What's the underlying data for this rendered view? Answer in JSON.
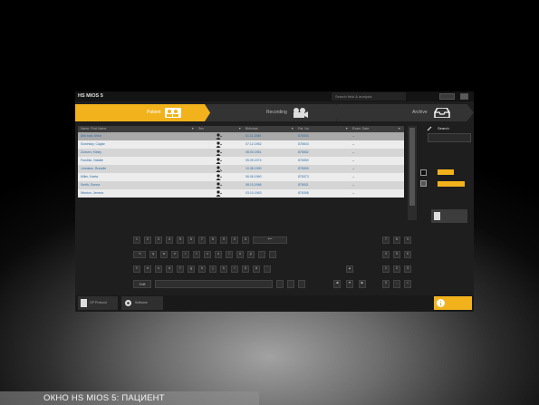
{
  "app": {
    "title": "HS MIOS 5",
    "search_placeholder": "Search field & analysis"
  },
  "tabs": [
    {
      "label": "Patient",
      "icon": "patients-icon",
      "active": true
    },
    {
      "label": "Recording",
      "icon": "camera-icon",
      "active": false
    },
    {
      "label": "Archive",
      "icon": "inbox-icon",
      "active": false
    }
  ],
  "table": {
    "headers": [
      "Name, First Name",
      "Sex",
      "Birthdate",
      "Pat. No.",
      "Exam. Date"
    ],
    "rows": [
      [
        "Abs bad, Ahnd",
        "",
        "01.11.1985",
        "876534",
        "--"
      ],
      [
        "Sowinsky, Caglar",
        "",
        "07.12.1962",
        "876543",
        "--"
      ],
      [
        "Zunsen, Kiesly",
        "",
        "08.03.1961",
        "876562",
        "--"
      ],
      [
        "Fandisk, Natalie",
        "",
        "05.09.1974",
        "876590",
        "--"
      ],
      [
        "Johnston, Brandie",
        "",
        "10.08.1990",
        "876590",
        "--"
      ],
      [
        "Miller, Kaeta",
        "",
        "06.06.1960",
        "876373",
        "--"
      ],
      [
        "Smith, Donna",
        "",
        "08.10.1966",
        "876531",
        "--"
      ],
      [
        "Weston, Jemma",
        "",
        "03.10.1963",
        "876398",
        "--"
      ]
    ]
  },
  "right_panel": {
    "search_label": "Search"
  },
  "keyboard": {
    "row1": [
      "1",
      "2",
      "3",
      "4",
      "5",
      "6",
      "7",
      "8",
      "9",
      "0",
      "ß"
    ],
    "row1_back": "⟵",
    "row2_tab": "⇥",
    "row2": [
      "q",
      "w",
      "e",
      "r",
      "t",
      "z",
      "u",
      "i",
      "o",
      "p"
    ],
    "row3_caps": "⇪",
    "row3": [
      "a",
      "s",
      "d",
      "f",
      "g",
      "h",
      "j",
      "k",
      "l",
      "ö",
      "ä"
    ],
    "row4_shift": "Shift",
    "numpad": [
      "7",
      "8",
      "9",
      "4",
      "5",
      "6",
      "1",
      "2",
      "3",
      "0",
      ",",
      "="
    ],
    "arrows": [
      "▲",
      "◀",
      "▼",
      "▶"
    ]
  },
  "bottom": {
    "new_patient": "OP Protocol",
    "settings": "Software"
  },
  "caption": "ОКНО HS MIOS 5: ПАЦИЕНТ",
  "colors": {
    "accent": "#f2b21c",
    "background": "#1e1e1e",
    "row_odd": "#d5d5d5",
    "row_even": "#ececec"
  }
}
